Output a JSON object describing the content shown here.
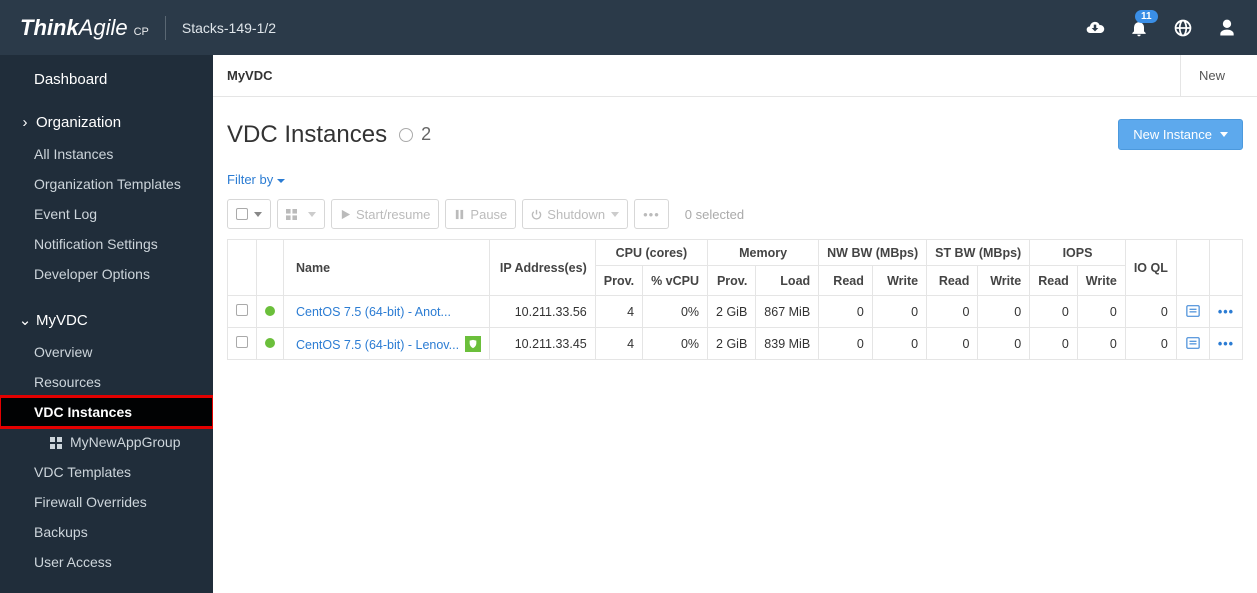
{
  "header": {
    "brand_think": "Think",
    "brand_agile": "Agile",
    "brand_cp": "CP",
    "context": "Stacks-149-1/2",
    "notification_count": "11"
  },
  "sidebar": {
    "dashboard": "Dashboard",
    "organization": "Organization",
    "org_items": [
      "All Instances",
      "Organization Templates",
      "Event Log",
      "Notification Settings",
      "Developer Options"
    ],
    "vdc": "MyVDC",
    "vdc_items": [
      "Overview",
      "Resources",
      "VDC Instances",
      "MyNewAppGroup",
      "VDC Templates",
      "Firewall Overrides",
      "Backups",
      "User Access"
    ]
  },
  "breadcrumb": {
    "current": "MyVDC",
    "action": "New"
  },
  "page": {
    "title": "VDC Instances",
    "count": "2",
    "new_button": "New Instance",
    "filter": "Filter by",
    "selected": "0 selected",
    "tools": {
      "start": "Start/resume",
      "pause": "Pause",
      "shutdown": "Shutdown"
    }
  },
  "table": {
    "groups": {
      "cpu": "CPU (cores)",
      "mem": "Memory",
      "nw": "NW BW (MBps)",
      "st": "ST BW (MBps)",
      "iops": "IOPS"
    },
    "cols": {
      "name": "Name",
      "ip": "IP Address(es)",
      "prov": "Prov.",
      "vcpu": "% vCPU",
      "load": "Load",
      "read": "Read",
      "write": "Write",
      "ioql": "IO QL"
    },
    "rows": [
      {
        "name": "CentOS 7.5 (64-bit) - Anot...",
        "ip": "10.211.33.56",
        "cpu_prov": "4",
        "vcpu": "0%",
        "mem_prov": "2 GiB",
        "mem_load": "867 MiB",
        "nw_r": "0",
        "nw_w": "0",
        "st_r": "0",
        "st_w": "0",
        "io_r": "0",
        "io_w": "0",
        "ioql": "0",
        "shield": false
      },
      {
        "name": "CentOS 7.5 (64-bit) - Lenov...",
        "ip": "10.211.33.45",
        "cpu_prov": "4",
        "vcpu": "0%",
        "mem_prov": "2 GiB",
        "mem_load": "839 MiB",
        "nw_r": "0",
        "nw_w": "0",
        "st_r": "0",
        "st_w": "0",
        "io_r": "0",
        "io_w": "0",
        "ioql": "0",
        "shield": true
      }
    ]
  }
}
